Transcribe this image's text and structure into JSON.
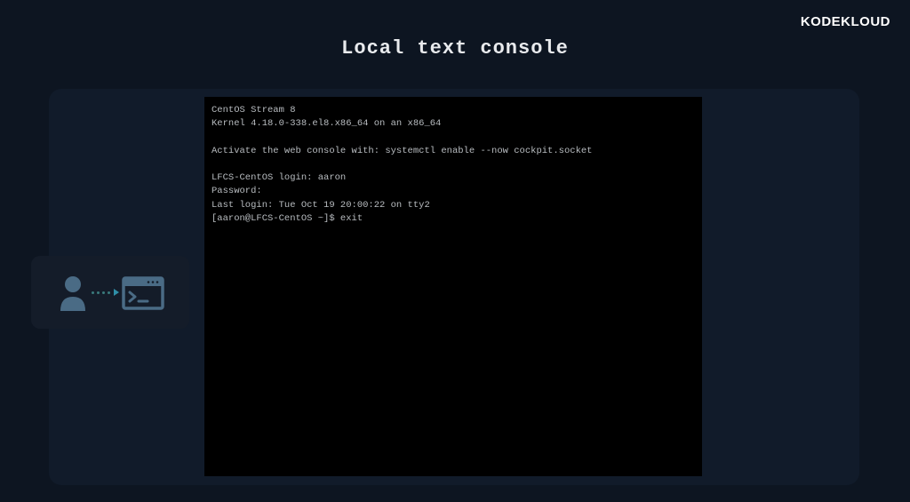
{
  "brand": {
    "name": "KODEKLOUD"
  },
  "page": {
    "title": "Local text console"
  },
  "terminal": {
    "lines": [
      "CentOS Stream 8",
      "Kernel 4.18.0-338.el8.x86_64 on an x86_64",
      "",
      "Activate the web console with: systemctl enable --now cockpit.socket",
      "",
      "LFCS-CentOS login: aaron",
      "Password:",
      "Last login: Tue Oct 19 20:00:22 on tty2",
      "[aaron@LFCS-CentOS ~]$ exit"
    ]
  },
  "icons": {
    "user_color": "#4a6b85",
    "console_color": "#4a6b85"
  }
}
